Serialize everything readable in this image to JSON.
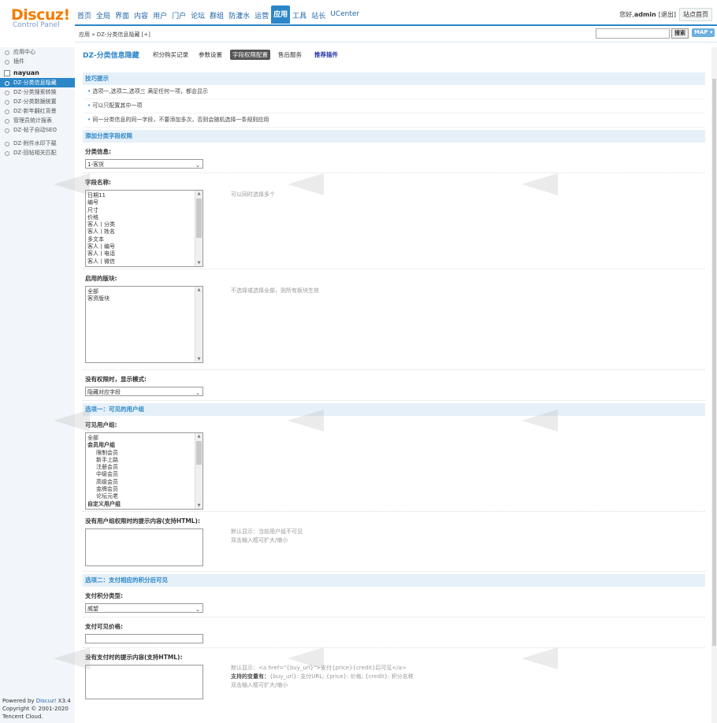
{
  "header": {
    "logo": "Discuz!",
    "logo_sub": "Control Panel",
    "nav": [
      "首页",
      "全局",
      "界面",
      "内容",
      "用户",
      "门户",
      "论坛",
      "群组",
      "防灌水",
      "运营",
      "应用",
      "工具",
      "站长",
      "UCenter"
    ],
    "active_nav": "应用",
    "greeting": "您好, ",
    "user": "admin",
    "logout": "[退出]",
    "home_btn": "站点首页"
  },
  "crumb": "应用 » DZ-分类信息隐藏 [+]",
  "search_btn": "搜索",
  "map_btn": "MAP ▾",
  "sidebar": {
    "items_top": [
      "应用中心",
      "插件"
    ],
    "group": "nayuan",
    "items": [
      "DZ-分类信息隐藏",
      "DZ-分类搜索转换",
      "DZ-分类数据统置",
      "DZ-新年翻红背景",
      "管理员统计报表",
      "DZ-帖子自动SEO",
      "DZ-附件水印下载",
      "DZ-回帖相关匹配"
    ],
    "active_item": "DZ-分类信息隐藏",
    "footer": [
      "Powered by ",
      "Discuz!",
      " X3.4",
      "Copyright © 2001-2020",
      "Tencent Cloud."
    ]
  },
  "subnav": {
    "title": "DZ-分类信息隐藏",
    "tabs": [
      "积分购买记录",
      "参数设置",
      "字段权限配置",
      "售后服务",
      "推荐插件"
    ],
    "current": "字段权限配置"
  },
  "tips": {
    "title": "技巧提示",
    "items": [
      "选项一,选项二,选项三 满足任何一项，都会显示",
      "可以只配置其中一项",
      "同一分类信息的同一字段，不要添加多次，否则会随机选择一条规则应用"
    ]
  },
  "add_section": "添加分类字段权限",
  "category": {
    "label": "分类信息:",
    "value": "1-客货"
  },
  "fields": {
    "label": "字段名称:",
    "options": [
      "日期11",
      "编号",
      "尺寸",
      "价格",
      "客人丨分类",
      "客人丨姓名",
      "多文本",
      "客人丨编号",
      "客人丨电话",
      "客人丨微信"
    ],
    "hint": "可以同时选择多个"
  },
  "blocks": {
    "label": "启用的版块:",
    "options": [
      "全部",
      "客资版块"
    ],
    "hint": "不选择或选择全部，则所有板块生效"
  },
  "mode": {
    "label": "没有权限时，显示模式:",
    "value": "隐藏对应字段"
  },
  "option1": "选项一：可见的用户组",
  "groups": {
    "label": "可见用户组:",
    "options": [
      {
        "t": "全部",
        "k": "n"
      },
      {
        "t": "会员用户组",
        "k": "g"
      },
      {
        "t": "限制会员",
        "k": "i"
      },
      {
        "t": "新手上路",
        "k": "i"
      },
      {
        "t": "注册会员",
        "k": "i"
      },
      {
        "t": "中级会员",
        "k": "i"
      },
      {
        "t": "高级会员",
        "k": "i"
      },
      {
        "t": "金牌会员",
        "k": "i"
      },
      {
        "t": "论坛元老",
        "k": "i"
      },
      {
        "t": "自定义用户组",
        "k": "g"
      }
    ]
  },
  "no_group_text": {
    "label": "没有用户组权限时的提示内容(支持HTML):",
    "hint1": "默认显示：当前用户组不可见",
    "hint2": "双击输入框可扩大/缩小"
  },
  "option2": "选项二：支付相应的积分后可见",
  "pay_type": {
    "label": "支付积分类型:",
    "value": "威望"
  },
  "pay_price": {
    "label": "支付可见价格:"
  },
  "no_pay_text": {
    "label": "没有支付时的提示内容(支持HTML):",
    "hint1": "默认显示：<a href=\"{buy_url}\">支付{price}{credit}后可见</a>",
    "hint2_b": "支持的变量有：",
    "hint2": "{buy_url}: 支付URL; {price}: 价格; {credit}: 积分名称",
    "hint3": "双击输入框可扩大/缩小"
  }
}
